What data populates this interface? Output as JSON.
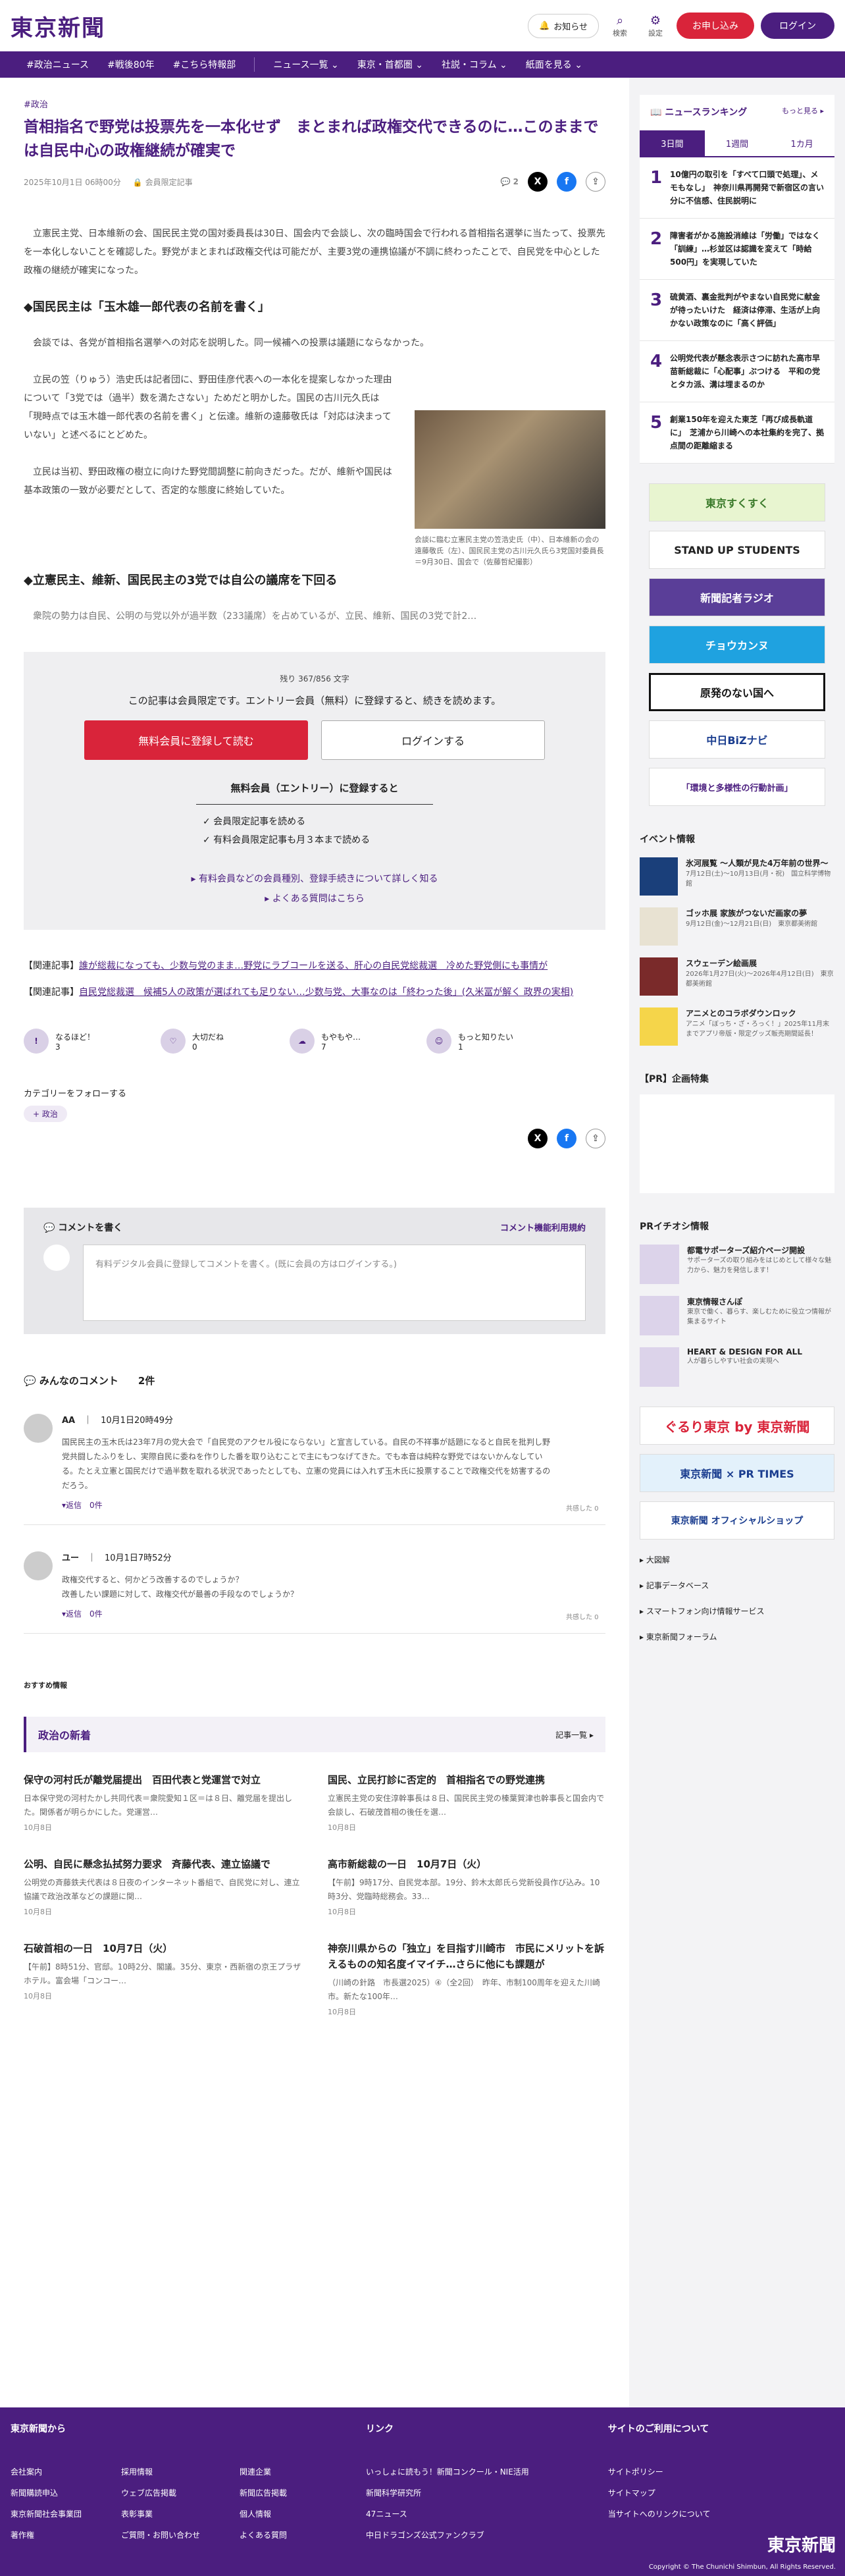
{
  "header": {
    "logo": "東京新聞",
    "notice": "お知らせ",
    "search": "検索",
    "settings": "設定",
    "register": "お申し込み",
    "login": "ログイン"
  },
  "nav": [
    "#政治ニュース",
    "#戦後80年",
    "#こちら特報部",
    "ニュース一覧 ⌄",
    "東京・首都圏 ⌄",
    "社説・コラム ⌄",
    "紙面を見る ⌄"
  ],
  "article": {
    "tag": "#政治",
    "title": "首相指名で野党は投票先を一本化せず　まとまれば政権交代できるのに…このままでは自民中心の政権継続が確実で",
    "date": "2025年10月1日 06時00分",
    "member": "会員限定記事",
    "comments": "2",
    "p1": "立憲民主党、日本維新の会、国民民主党の国対委員長は30日、国会内で会談し、次の臨時国会で行われる首相指名選挙に当たって、投票先を一本化しないことを確認した。野党がまとまれば政権交代は可能だが、主要3党の連携協議が不調に終わったことで、自民党を中心とした政権の継続が確実になった。",
    "h1": "◆国民民主は「玉木雄一郎代表の名前を書く」",
    "p2": "会談では、各党が首相指名選挙への対応を説明した。同一候補への投票は議題にならなかった。",
    "p3": "立民の笠（りゅう）浩史氏は記者団に、野田佳彦代表への一本化を提案しなかった理由について「3党では（過半）数を満たさない」ためだと明かした。国民の古川元久氏は「現時点では玉木雄一郎代表の名前を書く」と伝達。維新の遠藤敬氏は「対応は決まっていない」と述べるにとどめた。",
    "p4": "立民は当初、野田政権の樹立に向けた野党間調整に前向きだった。だが、維新や国民は基本政策の一致が必要だとして、否定的な態度に終始していた。",
    "h2": "◆立憲民主、維新、国民民主の3党では自公の議席を下回る",
    "p5": "衆院の勢力は自民、公明の与党以外が過半数（233議席）を占めているが、立民、維新、国民の3党で計2…",
    "caption": "会談に臨む立憲民主党の笠浩史氏（中）、日本維新の会の遠藤敬氏（左）、国民民主党の古川元久氏ら3党国対委員長＝9月30日、国会で（佐藤哲紀撮影）"
  },
  "paywall": {
    "remaining": "残り 367/856 文字",
    "message": "この記事は会員限定です。エントリー会員（無料）に登録すると、続きを読めます。",
    "primary": "無料会員に登録して読む",
    "secondary": "ログインする",
    "heading": "無料会員（エントリー）に登録すると",
    "benefits": [
      "✓ 会員限定記事を読める",
      "✓ 有料会員限定記事も月３本まで読める"
    ],
    "link1": "▸ 有料会員などの会員種別、登録手続きについて詳しく知る",
    "link2": "▸ よくある質問はこちら"
  },
  "related": [
    {
      "label": "【関連記事】",
      "text": "誰が総裁になっても、少数与党のまま…野党にラブコールを送る、肝心の自民党総裁選　冷めた野党側にも事情が"
    },
    {
      "label": "【関連記事】",
      "text": "自民党総裁選　候補5人の政策が選ばれても足りない…少数与党、大事なのは「終わった後」(久米冨が解く 政界の実相)"
    }
  ],
  "reactions": [
    {
      "label": "なるほど！",
      "count": "3"
    },
    {
      "label": "大切だね",
      "count": "0"
    },
    {
      "label": "もやもや…",
      "count": "7"
    },
    {
      "label": "もっと知りたい",
      "count": "1"
    }
  ],
  "follow": {
    "heading": "カテゴリーをフォローする",
    "badge": "+ 政治"
  },
  "comment": {
    "write": "コメントを書く",
    "rules": "コメント機能利用規約",
    "prompt": "有料デジタル会員に登録してコメントを書く。(既に会員の方はログインする。)",
    "list": "みんなのコメント　　2件",
    "items": [
      {
        "name": "AA",
        "date": "10月1日20時49分",
        "text": "国民民主の玉木氏は23年7月の党大会で「自民党のアクセル役にならない」と宣言している。自民の不祥事が話題になると自民を批判し野党共闘したふりをし、実際自民に委ねを作りした番を取り込むことで主にもつなげてきた。でも本音は純粋な野党ではないかんなしている。たとえ立憲と国民だけで過半数を取れる状況であったとしても、立憲の党員には入れず玉木氏に投票することで政権交代を妨害するのだろう。",
        "reply": "▾返信　0件",
        "like": "共感した 0"
      },
      {
        "name": "ユー",
        "date": "10月1日7時52分",
        "text": "政権交代すると、何かどう改善するのでしょうか？\n改善したい課題に対して、政権交代が最善の手段なのでしょうか？",
        "reply": "▾返信　0件",
        "like": "共感した 0"
      }
    ]
  },
  "recommend": "おすすめ情報",
  "latest": {
    "title": "政治の新着",
    "more": "記事一覧 ▸",
    "items": [
      {
        "h": "保守の河村氏が離党届提出　百田代表と党運営で対立",
        "d": "日本保守党の河村たかし共同代表＝衆院愛知１区＝は８日、離党届を提出した。関係者が明らかにした。党運営…",
        "dt": "10月8日"
      },
      {
        "h": "国民、立民打診に否定的　首相指名での野党連携",
        "d": "立憲民主党の安住淳幹事長は８日、国民民主党の榛葉賀津也幹事長と国会内で会談し、石破茂首相の後任を選…",
        "dt": "10月8日"
      },
      {
        "h": "公明、自民に懸念払拭努力要求　斉藤代表、連立協議で",
        "d": "公明党の斉藤鉄夫代表は８日夜のインターネット番組で、自民党に対し、連立協議で政治改革などの課題に関…",
        "dt": "10月8日"
      },
      {
        "h": "高市新総裁の一日　10月7日（火）",
        "d": "【午前】9時17分、自民党本部。19分、鈴木太郎氏ら党新役員作び込み。10時3分、党臨時総務会。33…",
        "dt": "10月8日"
      },
      {
        "h": "石破首相の一日　10月7日（火）",
        "d": "【午前】8時51分、官邸。10時2分、閣議。35分、東京・西新宿の京王プラザホテル。富会場「コンコー…",
        "dt": "10月8日"
      },
      {
        "h": "神奈川県からの「独立」を目指す川崎市　市民にメリットを訴えるものの知名度イマイチ…さらに他にも課題が",
        "d": "（川崎の針路　市長選2025）④（全2回）　昨年、市制100周年を迎えた川崎市。新たな100年…",
        "dt": "10月8日"
      }
    ]
  },
  "ranking": {
    "title": "ニュースランキング",
    "more": "もっと見る ▸",
    "tabs": [
      "3日間",
      "1週間",
      "1カ月"
    ],
    "items": [
      {
        "n": "1",
        "t": "10億円の取引を「すべて口頭で処理」、メモもなし」　神奈川県再開発で新宿区の言い分に不信感、住民説明に"
      },
      {
        "n": "2",
        "t": "障害者がかる施設消維は「労働」ではなく「訓練」…杉並区は認識を変えて「時給500円」を実現していた"
      },
      {
        "n": "3",
        "t": "硫黄酒、裏金批判がやまない自民党に献金が待ったいけた　経済は停滞、生活が上向かない政策なのに「高く評価」"
      },
      {
        "n": "4",
        "t": "公明党代表が懸念表示さつに訪れた高市早苗新総裁に「心配事」ぶつける　平和の党とタカ派、溝は埋まるのか"
      },
      {
        "n": "5",
        "t": "創業150年を迎えた東芝「再び成長軌道に」　芝浦から川崎への本社集約を完了、拠点間の距離縮まる"
      }
    ]
  },
  "banners": [
    "東京すくすく",
    "STAND UP STUDENTS",
    "新聞記者ラジオ",
    "チョウカンヌ",
    "原発のない国へ",
    "中日BiZナビ",
    "「環境と多様性の行動計画」"
  ],
  "events": {
    "title": "イベント情報",
    "items": [
      {
        "t": "氷河展覧 〜人類が見た4万年前の世界〜",
        "d": "7月12日(土)〜10月13日(月・祝)　国立科学博物館"
      },
      {
        "t": "ゴッホ展 家族がつないだ画家の夢",
        "d": "9月12日(金)〜12月21日(日)　東京都美術館"
      },
      {
        "t": "スウェーデン絵画展",
        "d": "2026年1月27日(火)〜2026年4月12日(日)　東京都美術館"
      },
      {
        "t": "アニメとのコラボダウンロック",
        "d": "アニメ「ぼっち・ざ・ろっく！」2025年11月末までアプリ帝版・限定グッズ販売期間延長！"
      }
    ]
  },
  "prplan": "【PR】企画特集",
  "prinfo": {
    "title": "PRイチオシ情報",
    "items": [
      {
        "t": "都電サポーターズ紹介ページ開設",
        "d": "サポーターズの取り組みをはじめとして様々な魅力から、魅力を発信します！"
      },
      {
        "t": "東京情報さんぽ",
        "d": "東京で働く、暮らす、楽しむために役立つ情報が集まるサイト"
      },
      {
        "t": "HEART & DESIGN FOR ALL",
        "d": "人が暮らしやすい社会の実現へ"
      }
    ]
  },
  "sidebanners": [
    "ぐるり東京 by 東京新聞",
    "東京新聞 × PR TIMES",
    "東京新聞 オフィシャルショップ"
  ],
  "sidelinks": [
    "▸ 大図解",
    "▸ 記事データベース",
    "▸ スマートフォン向け情報サービス",
    "▸ 東京新聞フォーラム"
  ],
  "footer": {
    "c1h": "東京新聞から",
    "c1": [
      "会社案内",
      "新聞購読申込",
      "東京新聞社会事業団",
      "著作権"
    ],
    "c1b": [
      "採用情報",
      "ウェブ広告掲載",
      "表彰事業",
      "ご質問・お問い合わせ"
    ],
    "c1c": [
      "関連企業",
      "新聞広告掲載",
      "個人情報",
      "よくある質問"
    ],
    "c2h": "リンク",
    "c2": [
      "いっしょに読もう！新聞コンクール・NIE活用",
      "新聞科学研究所",
      "47ニュース",
      "中日ドラゴンズ公式ファンクラブ"
    ],
    "c3h": "サイトのご利用について",
    "c3": [
      "サイトポリシー",
      "サイトマップ",
      "当サイトへのリンクについて"
    ],
    "logo": "東京新聞",
    "copy": "Copyright © The Chunichi Shimbun, All Rights Reserved."
  }
}
